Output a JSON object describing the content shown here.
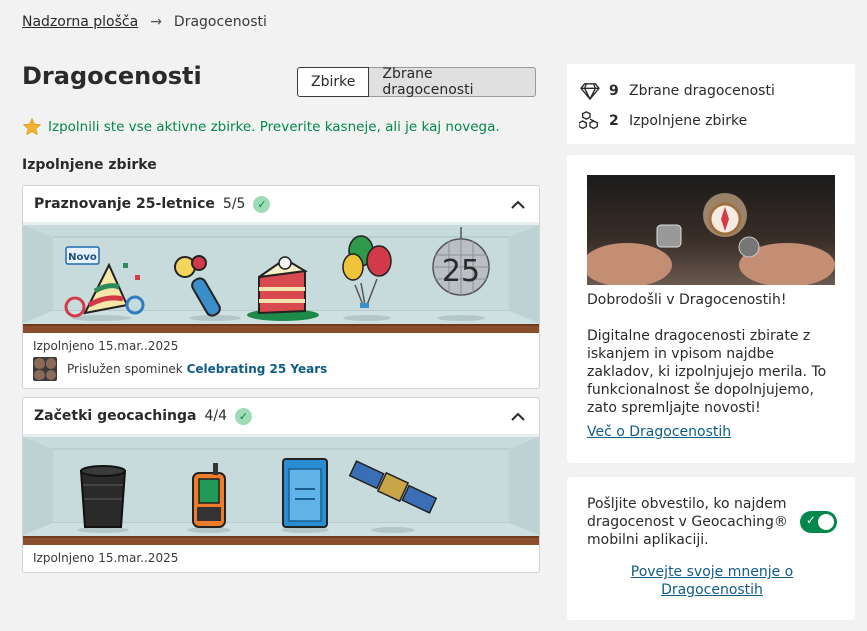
{
  "breadcrumb": {
    "parent": "Nadzorna plošča",
    "separator": "→",
    "current": "Dragocenosti"
  },
  "page_title": "Dragocenosti",
  "tabs": [
    {
      "label": "Zbirke",
      "active": true
    },
    {
      "label": "Zbrane dragocenosti",
      "active": false
    }
  ],
  "notice": "Izpolnili ste vse aktivne zbirke. Preverite kasneje, ali je kaj novega.",
  "section_heading": "Izpolnjene zbirke",
  "collections": [
    {
      "name": "Praznovanje 25-letnice",
      "count": "5/5",
      "badge": "Novo",
      "items": [
        "party-hat-confetti",
        "party-horn",
        "birthday-cake",
        "balloons",
        "disco-ball-25"
      ],
      "completed": "Izpolnjeno 15.mar..2025",
      "souvenir_prefix": "Prislužen spominek",
      "souvenir_name": "Celebrating 25 Years"
    },
    {
      "name": "Začetki geocachinga",
      "count": "4/4",
      "items": [
        "bucket",
        "gps-device",
        "selective-availability-panel",
        "satellite"
      ],
      "completed": "Izpolnjeno 15.mar..2025"
    }
  ],
  "stats": [
    {
      "icon": "diamond-icon",
      "value": "9",
      "label": "Zbrane dragocenosti"
    },
    {
      "icon": "cubes-icon",
      "value": "2",
      "label": "Izpolnjene zbirke"
    }
  ],
  "news": {
    "image": "hands-holding-compass-photo",
    "welcome": "Dobrodošli v Dragocenostih!",
    "body": "Digitalne dragocenosti zbirate z iskanjem in vpisom najdbe zakladov, ki izpolnjujejo merila. To funkcionalnost še dopolnjujemo, zato spremljajte novosti!",
    "link": "Več o Dragocenostih"
  },
  "notify": {
    "text": "Pošljite obvestilo, ko najdem dragocenost v Geocaching® mobilni aplikaciji.",
    "enabled": true,
    "feedback_link": "Povejte svoje mnenje o Dragocenostih"
  },
  "colors": {
    "accent_green": "#02874d",
    "link_blue": "#0f5c88",
    "shelf_wood": "#8a4e2c"
  }
}
